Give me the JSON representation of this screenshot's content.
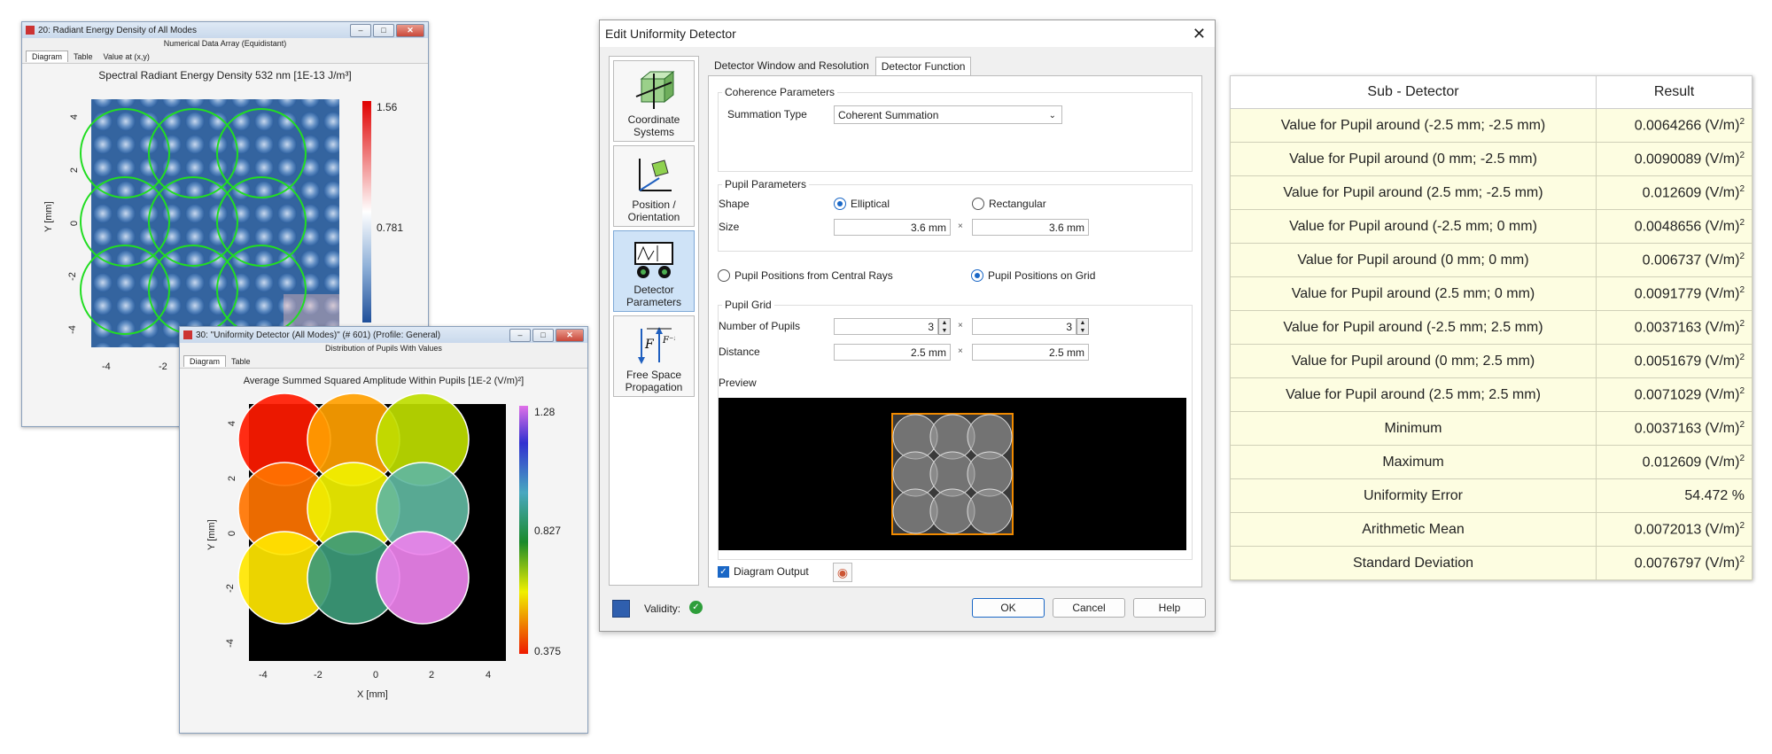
{
  "window1": {
    "title": "20: Radiant Energy Density of All Modes",
    "subtitle": "Numerical Data Array (Equidistant)",
    "tabs": [
      "Diagram",
      "Table",
      "Value at (x,y)"
    ],
    "plot_title": "Spectral Radiant Energy Density 532 nm  [1E-13 J/m³]",
    "ylabel": "Y [mm]",
    "yticks": [
      "4",
      "2",
      "0",
      "-2",
      "-4"
    ],
    "xticks": [
      "-4",
      "-2"
    ],
    "colorbar": {
      "max": "1.56",
      "mid": "0.781"
    }
  },
  "window2": {
    "title": "30: \"Uniformity Detector (All Modes)\" (# 601) (Profile: General)",
    "subtitle": "Distribution of Pupils With Values",
    "tabs": [
      "Diagram",
      "Table"
    ],
    "plot_title": "Average Summed Squared Amplitude Within Pupils  [1E-2 (V/m)²]",
    "xlabel": "X [mm]",
    "ylabel": "Y [mm]",
    "xticks": [
      "-4",
      "-2",
      "0",
      "2",
      "4"
    ],
    "yticks": [
      "4",
      "2",
      "0",
      "-2",
      "-4"
    ],
    "colorbar": {
      "max": "1.28",
      "mid": "0.827",
      "min": "0.375"
    },
    "pupil_colors": {
      "row_top": [
        "#ff1a00",
        "#ffa000",
        "#bedd00"
      ],
      "row_mid": [
        "#ff7400",
        "#f0f000",
        "#5fb7a0"
      ],
      "row_bot": [
        "#ffe600",
        "#3c9a78",
        "#ec82ec"
      ]
    }
  },
  "dialog": {
    "title": "Edit Uniformity Detector",
    "sidebar": [
      "Coordinate Systems",
      "Position / Orientation",
      "Detector Parameters",
      "Free Space Propagation"
    ],
    "tabs": [
      "Detector Window and Resolution",
      "Detector Function"
    ],
    "coherence": {
      "group": "Coherence Parameters",
      "summation_label": "Summation Type",
      "summation_value": "Coherent Summation"
    },
    "pupil": {
      "group": "Pupil Parameters",
      "shape_label": "Shape",
      "shape_options": [
        "Elliptical",
        "Rectangular"
      ],
      "shape_selected": "Elliptical",
      "size_label": "Size",
      "size_x": "3.6 mm",
      "size_y": "3.6 mm"
    },
    "positions": {
      "options": [
        "Pupil Positions from Central Rays",
        "Pupil Positions on Grid"
      ],
      "selected": "Pupil Positions on Grid"
    },
    "grid": {
      "group": "Pupil Grid",
      "number_label": "Number of Pupils",
      "number_x": "3",
      "number_y": "3",
      "distance_label": "Distance",
      "distance_x": "2.5 mm",
      "distance_y": "2.5 mm"
    },
    "preview_label": "Preview",
    "diagram_output_label": "Diagram Output",
    "diagram_output_checked": true,
    "validity_label": "Validity:",
    "buttons": {
      "ok": "OK",
      "cancel": "Cancel",
      "help": "Help"
    }
  },
  "results": {
    "headers": [
      "Sub - Detector",
      "Result"
    ],
    "unit": "(V/m)",
    "rows": [
      {
        "label": "Value for Pupil around (-2.5 mm; -2.5 mm)",
        "value": "0.0064266"
      },
      {
        "label": "Value for Pupil around (0 mm; -2.5 mm)",
        "value": "0.0090089"
      },
      {
        "label": "Value for Pupil around (2.5 mm; -2.5 mm)",
        "value": "0.012609"
      },
      {
        "label": "Value for Pupil around (-2.5 mm; 0 mm)",
        "value": "0.0048656"
      },
      {
        "label": "Value for Pupil around (0 mm; 0 mm)",
        "value": "0.006737"
      },
      {
        "label": "Value for Pupil around (2.5 mm; 0 mm)",
        "value": "0.0091779"
      },
      {
        "label": "Value for Pupil around (-2.5 mm; 2.5 mm)",
        "value": "0.0037163"
      },
      {
        "label": "Value for Pupil around (0 mm; 2.5 mm)",
        "value": "0.0051679"
      },
      {
        "label": "Value for Pupil around (2.5 mm; 2.5 mm)",
        "value": "0.0071029"
      },
      {
        "label": "Minimum",
        "value": "0.0037163"
      },
      {
        "label": "Maximum",
        "value": "0.012609"
      },
      {
        "label": "Uniformity Error",
        "value": "54.472 %"
      },
      {
        "label": "Arithmetic Mean",
        "value": "0.0072013"
      },
      {
        "label": "Standard Deviation",
        "value": "0.0076797"
      }
    ]
  }
}
